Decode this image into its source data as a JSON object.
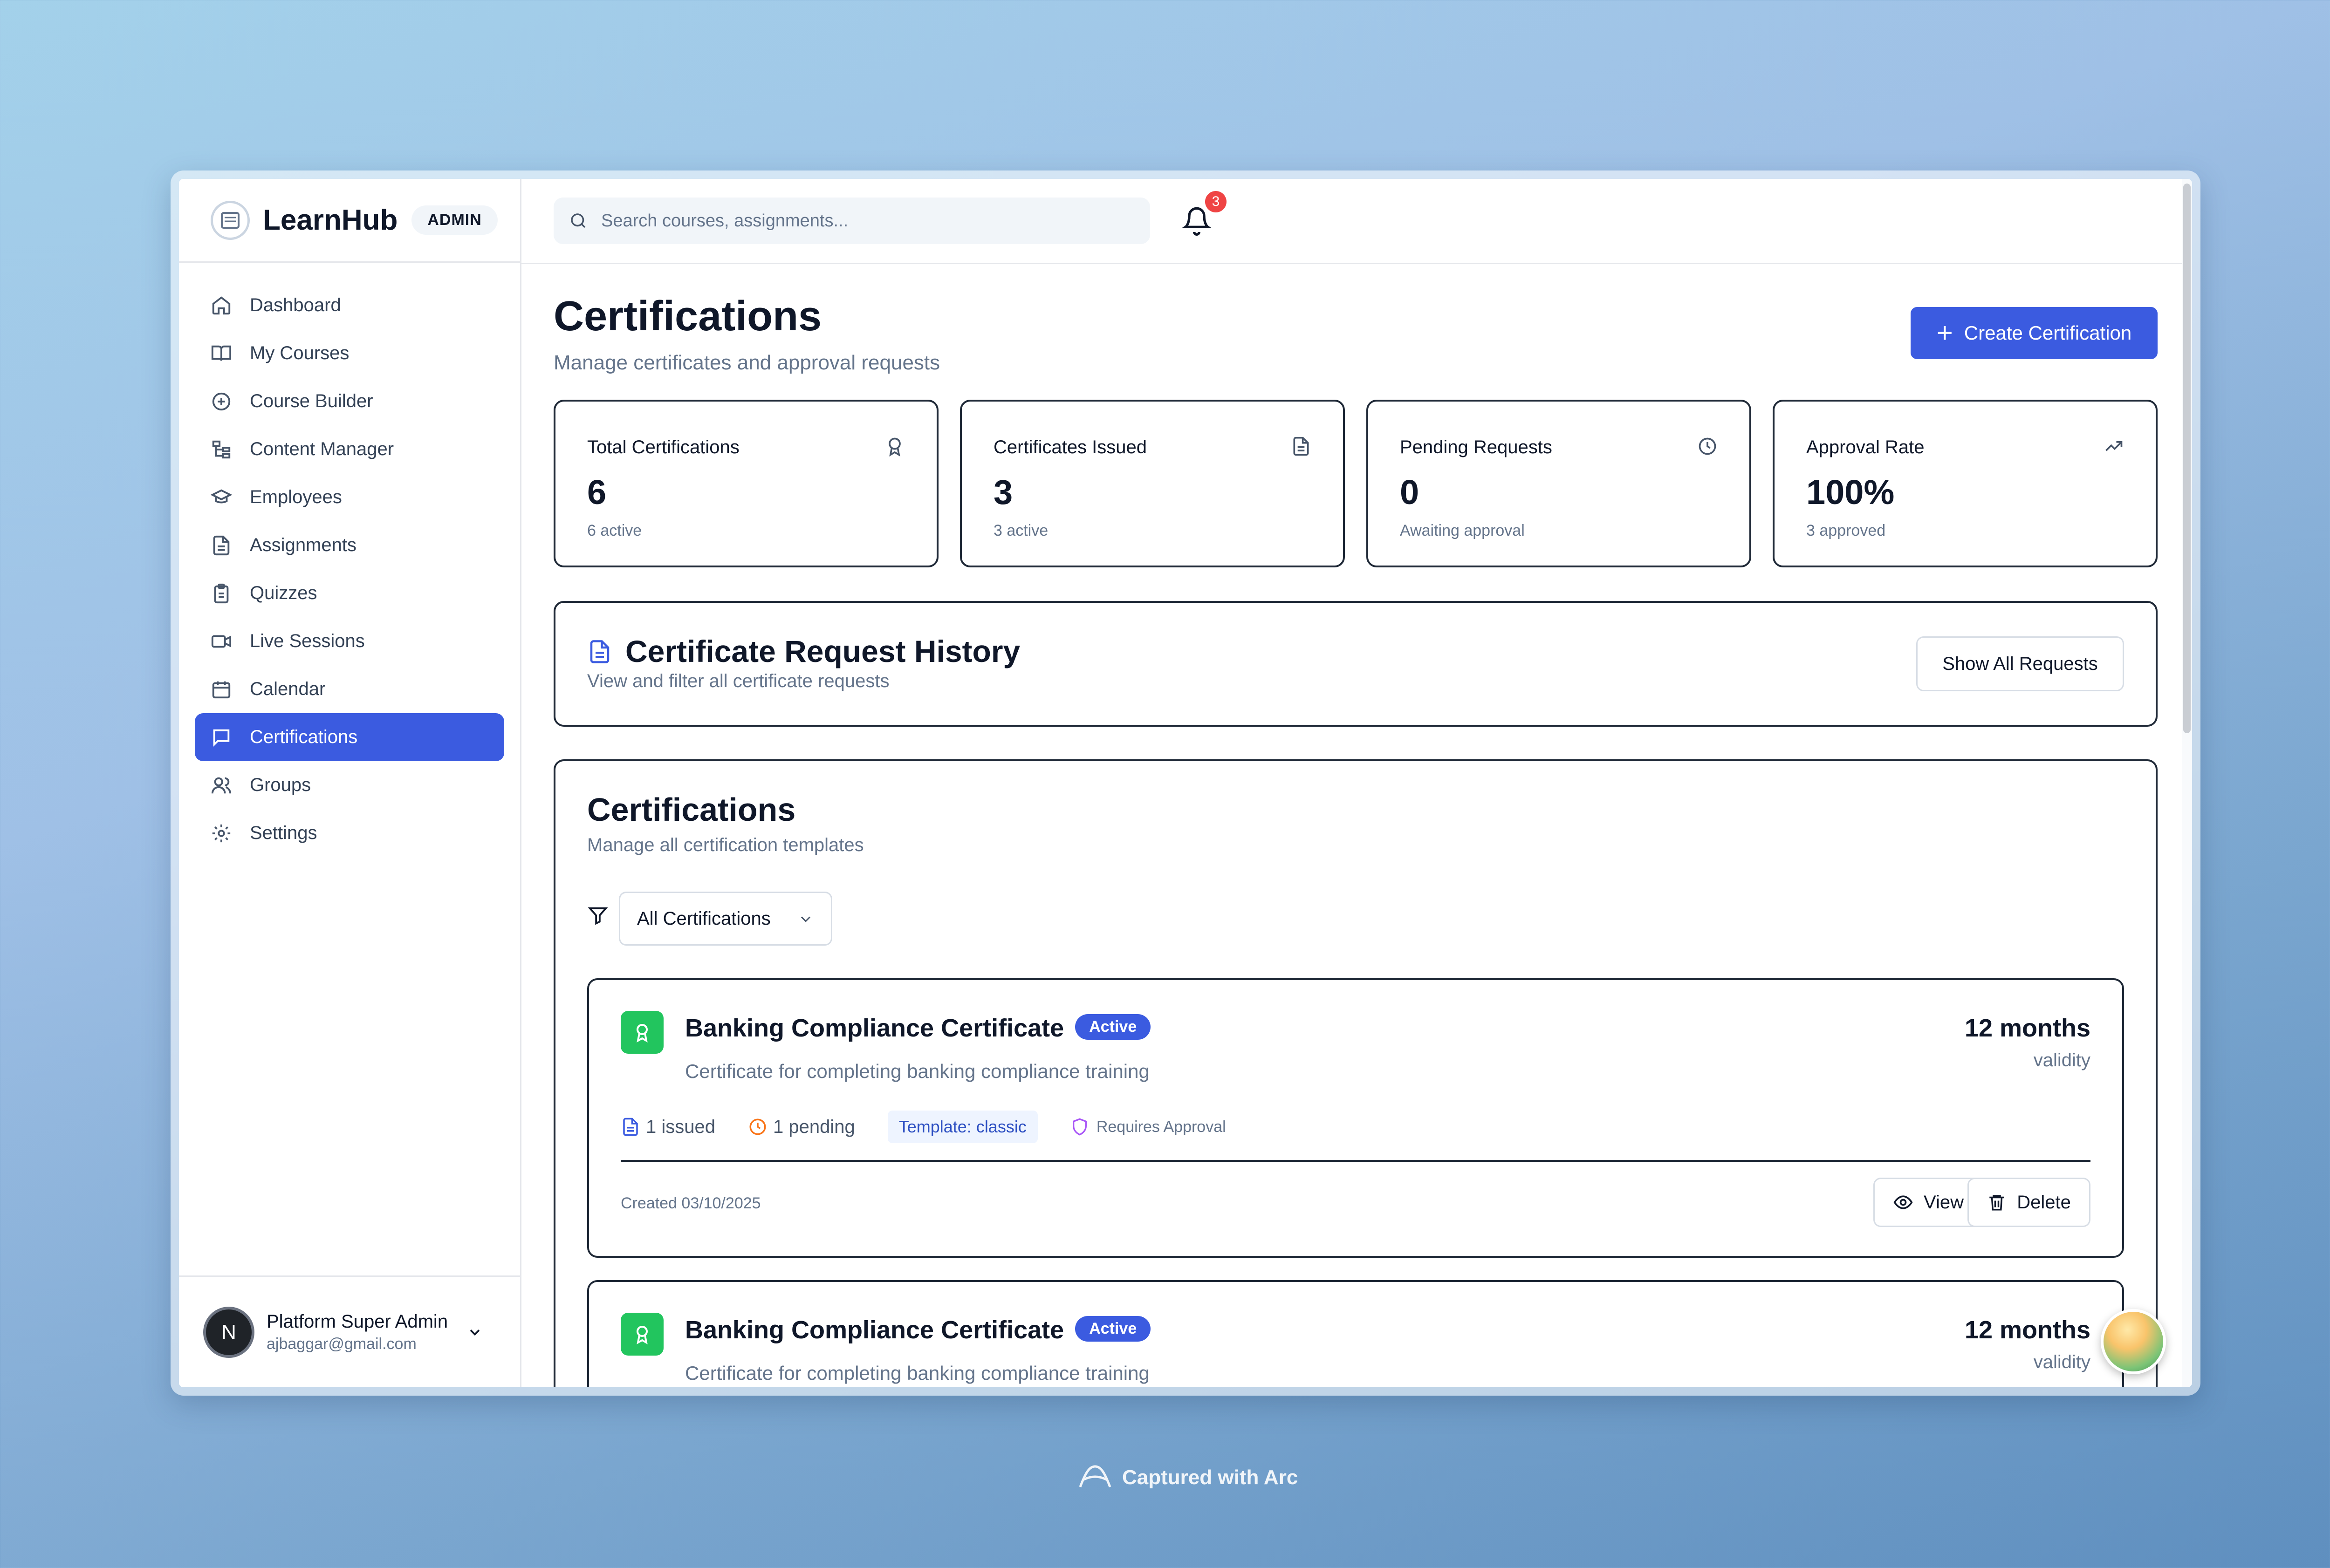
{
  "brand": {
    "name": "LearnHub",
    "badge": "ADMIN"
  },
  "sidebar": {
    "items": [
      {
        "label": "Dashboard",
        "icon": "home-icon"
      },
      {
        "label": "My Courses",
        "icon": "book-icon"
      },
      {
        "label": "Course Builder",
        "icon": "plus-circle-icon"
      },
      {
        "label": "Content Manager",
        "icon": "tree-icon"
      },
      {
        "label": "Employees",
        "icon": "graduation-cap-icon"
      },
      {
        "label": "Assignments",
        "icon": "file-icon"
      },
      {
        "label": "Quizzes",
        "icon": "clipboard-icon"
      },
      {
        "label": "Live Sessions",
        "icon": "video-icon"
      },
      {
        "label": "Calendar",
        "icon": "calendar-icon"
      },
      {
        "label": "Certifications",
        "icon": "message-square-icon",
        "active": true
      },
      {
        "label": "Groups",
        "icon": "users-icon"
      },
      {
        "label": "Settings",
        "icon": "gear-icon"
      }
    ]
  },
  "user": {
    "initial": "N",
    "name": "Platform Super Admin",
    "email": "ajbaggar@gmail.com"
  },
  "topbar": {
    "search_placeholder": "Search courses, assignments...",
    "notification_count": "3"
  },
  "page": {
    "title": "Certifications",
    "subtitle": "Manage certificates and approval requests",
    "create_button": "Create Certification"
  },
  "stats": [
    {
      "label": "Total Certifications",
      "value": "6",
      "sub": "6 active",
      "icon": "award-icon"
    },
    {
      "label": "Certificates Issued",
      "value": "3",
      "sub": "3 active",
      "icon": "document-icon"
    },
    {
      "label": "Pending Requests",
      "value": "0",
      "sub": "Awaiting approval",
      "icon": "clock-icon"
    },
    {
      "label": "Approval Rate",
      "value": "100%",
      "sub": "3 approved",
      "icon": "trending-up-icon"
    }
  ],
  "history": {
    "title": "Certificate Request History",
    "subtitle": "View and filter all certificate requests",
    "button": "Show All Requests"
  },
  "certs": {
    "title": "Certifications",
    "subtitle": "Manage all certification templates",
    "filter_value": "All Certifications",
    "cards": [
      {
        "title": "Banking Compliance Certificate",
        "status": "Active",
        "description": "Certificate for completing banking compliance training",
        "validity": "12 months",
        "validity_label": "validity",
        "issued": "1 issued",
        "pending": "1 pending",
        "template_label": "Template:",
        "template_value": "classic",
        "approval": "Requires Approval",
        "created": "Created 03/10/2025",
        "view": "View",
        "delete": "Delete"
      },
      {
        "title": "Banking Compliance Certificate",
        "status": "Active",
        "description": "Certificate for completing banking compliance training",
        "validity": "12 months",
        "validity_label": "validity"
      }
    ]
  },
  "footer": {
    "capture_label": "Captured with Arc"
  },
  "colors": {
    "accent": "#3b5be0",
    "success": "#22c55e",
    "danger": "#ef4444",
    "muted": "#64748b"
  }
}
